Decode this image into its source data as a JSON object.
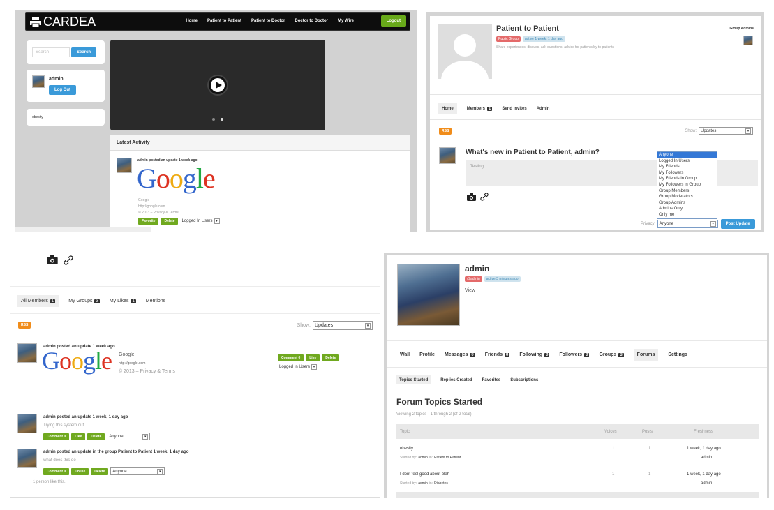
{
  "panel1": {
    "brand": "CARDEA",
    "nav": [
      "Home",
      "Patient to Patient",
      "Patient to Doctor",
      "Doctor to Doctor",
      "My Wire"
    ],
    "logout": "Logout",
    "search_placeholder": "Search",
    "search_button": "Search",
    "username": "admin",
    "logout_button": "Log Out",
    "tag": "obesity",
    "latest_activity": "Latest Activity",
    "activity_title": "admin posted an update 1 week ago",
    "google_caption": "Google",
    "google_url": "http://google.com",
    "google_footer": "© 2013 – Privacy & Terms",
    "favorite": "Favorite",
    "delete": "Delete",
    "privacy_value": "Logged In Users"
  },
  "panel2": {
    "group_name": "Patient to Patient",
    "public_badge": "Public Group",
    "active_badge": "active 1 week, 1 day ago",
    "description": "Share experiences, discuss, ask questions, advice for patients by to patients",
    "group_admins": "Group Admins",
    "tabs": [
      {
        "label": "Home"
      },
      {
        "label": "Members",
        "count": "1"
      },
      {
        "label": "Send Invites"
      },
      {
        "label": "Admin"
      }
    ],
    "rss": "RSS",
    "show_label": "Show:",
    "show_value": "Updates",
    "whats_new": "What's new in Patient to Patient, admin?",
    "textarea_value": "Testing",
    "privacy_label": "Privacy",
    "privacy_value": "Anyone",
    "post_button": "Post Update",
    "privacy_options": [
      "Anyone",
      "Logged In Users",
      "My Friends",
      "My Followers",
      "My Friends in Group",
      "My Followers in Group",
      "Group Members",
      "Group Moderators",
      "Group Admins",
      "Admins Only",
      "Only me"
    ]
  },
  "panel3": {
    "tabs": [
      {
        "label": "All Members",
        "count": "1"
      },
      {
        "label": "My Groups",
        "count": "3"
      },
      {
        "label": "My Likes",
        "count": "1"
      },
      {
        "label": "Mentions"
      }
    ],
    "rss": "RSS",
    "show_label": "Show:",
    "show_value": "Updates",
    "item1_title": "admin posted an update 1 week ago",
    "google_caption": "Google",
    "google_url": "http://google.com",
    "google_footer": "© 2013 – Privacy & Terms",
    "comment": "Comment",
    "comment_count": "0",
    "like": "Like",
    "unlike": "Unlike",
    "delete": "Delete",
    "item1_privacy": "Logged In Users",
    "item2_title": "admin posted an update 1 week, 1 day ago",
    "item2_text": "Trying this system out",
    "item2_privacy": "Anyone",
    "item3_title": "admin posted an update in the group Patient to Patient 1 week, 1 day ago",
    "item3_text": "what does this do",
    "item3_privacy": "Anyone",
    "likes_note": "1 person like this."
  },
  "panel4": {
    "name": "admin",
    "handle_badge": "@admin",
    "active_badge": "active 3 minutes ago",
    "view": "View",
    "tabs": [
      {
        "label": "Wall"
      },
      {
        "label": "Profile"
      },
      {
        "label": "Messages",
        "count": "0"
      },
      {
        "label": "Friends",
        "count": "0"
      },
      {
        "label": "Following",
        "count": "0"
      },
      {
        "label": "Followers",
        "count": "0"
      },
      {
        "label": "Groups",
        "count": "3"
      },
      {
        "label": "Forums"
      },
      {
        "label": "Settings"
      }
    ],
    "subtabs": [
      "Topics Started",
      "Replies Created",
      "Favorites",
      "Subscriptions"
    ],
    "heading": "Forum Topics Started",
    "viewing": "Viewing 2 topics - 1 through 2 (of 2 total)",
    "columns": [
      "Topic",
      "Voices",
      "Posts",
      "Freshness"
    ],
    "rows": [
      {
        "topic": "obesity",
        "started_by": "Started by:",
        "author": "admin",
        "in": "in:",
        "group": "Patient to Patient",
        "voices": "1",
        "posts": "1",
        "fresh": "1 week, 1 day ago",
        "fresh_by": "admin"
      },
      {
        "topic": "I dont feel good about blah",
        "started_by": "Started by:",
        "author": "admin",
        "in": "in:",
        "group": "Diabetes",
        "voices": "1",
        "posts": "1",
        "fresh": "1 week, 1 day ago",
        "fresh_by": "admin"
      }
    ]
  }
}
